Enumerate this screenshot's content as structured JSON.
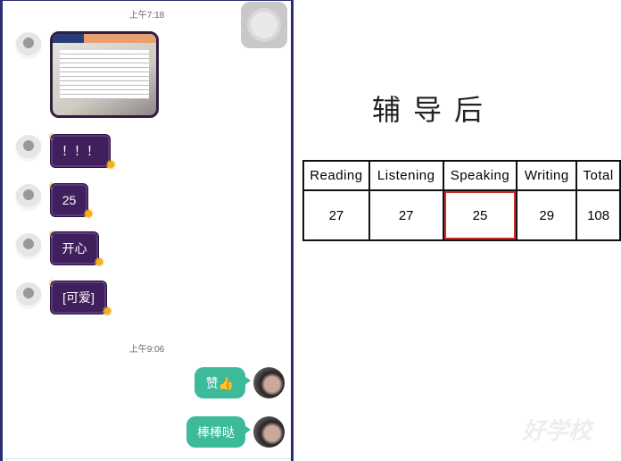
{
  "chat": {
    "timestamps": [
      "上午7:18",
      "上午9:06"
    ],
    "incoming": [
      {
        "type": "image",
        "content": "TOEFL score report photo"
      },
      {
        "text": "！！！"
      },
      {
        "text": "25"
      },
      {
        "text": "开心"
      },
      {
        "text": "[可爱]"
      }
    ],
    "outgoing": [
      {
        "text": "赞👍"
      },
      {
        "text": "棒棒哒"
      }
    ],
    "colors": {
      "incoming_bubble": "#3f1f5c",
      "outgoing_bubble": "#3dba9a",
      "frame": "#2b2f72"
    }
  },
  "score_panel": {
    "title": "辅导后",
    "headers": [
      "Reading",
      "Listening",
      "Speaking",
      "Writing",
      "Total"
    ],
    "scores": [
      "27",
      "27",
      "25",
      "29",
      "108"
    ],
    "highlighted": "Speaking",
    "highlight_color": "#c9302c"
  },
  "watermark": "好学校"
}
